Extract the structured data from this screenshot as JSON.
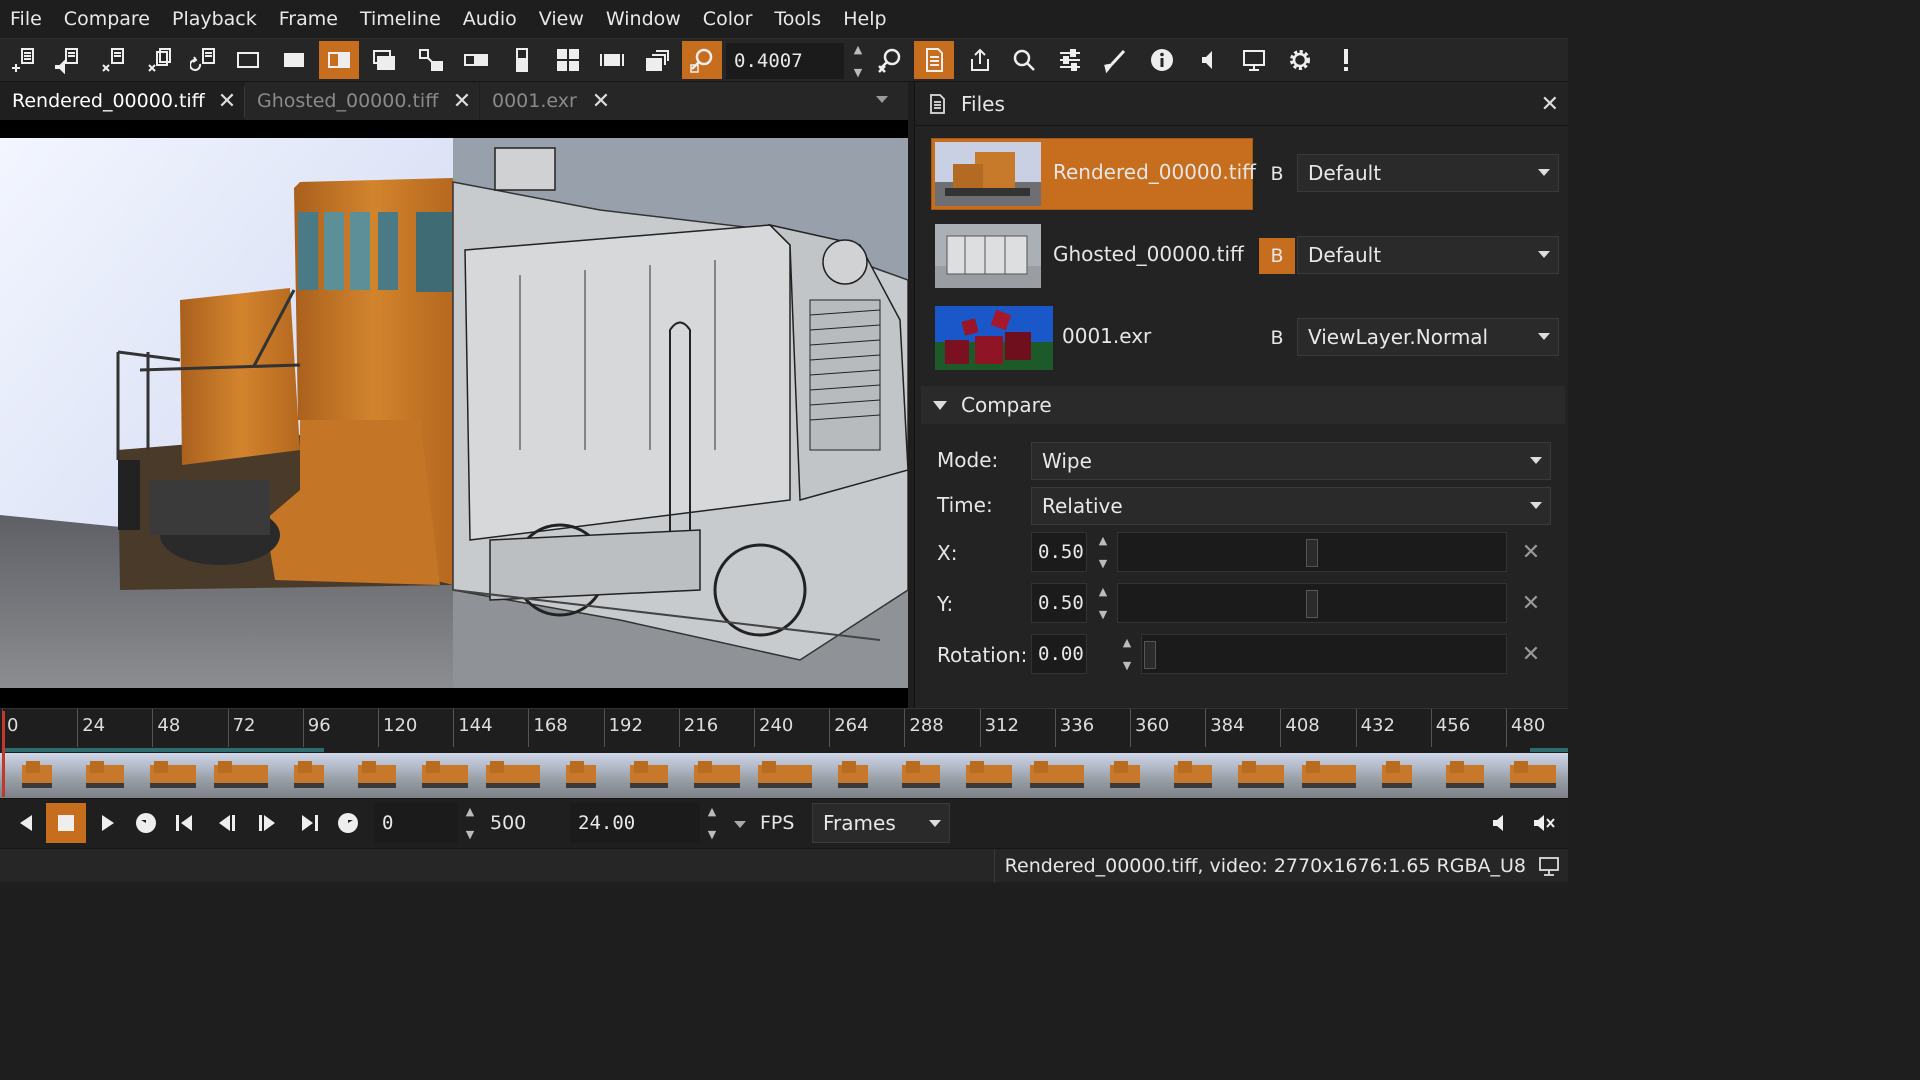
{
  "menu": [
    "File",
    "Compare",
    "Playback",
    "Frame",
    "Timeline",
    "Audio",
    "View",
    "Window",
    "Color",
    "Tools",
    "Help"
  ],
  "toolbar": {
    "zoom_value": "0.4007",
    "icons": [
      "open-icon",
      "open-audio-icon",
      "close-icon",
      "close-all-icon",
      "reload-icon",
      "compare-a-icon",
      "compare-b-icon",
      "compare-wipe-icon",
      "compare-overlay-icon",
      "compare-difference-icon",
      "compare-horizontal-icon",
      "compare-vertical-icon",
      "compare-tile-icon",
      "frame-view-icon",
      "full-screen-icon",
      "zoom-fit-icon",
      "zoom-reset-icon",
      "files-icon",
      "export-icon",
      "view-icon",
      "color-controls-icon",
      "annotation-icon",
      "info-icon",
      "audio-icon",
      "devices-icon",
      "settings-icon",
      "messages-icon"
    ],
    "active": [
      "compare-wipe-icon",
      "zoom-fit-icon",
      "files-icon"
    ]
  },
  "tabs": [
    {
      "label": "Rendered_00000.tiff",
      "active": true
    },
    {
      "label": "Ghosted_00000.tiff",
      "active": false
    },
    {
      "label": "0001.exr",
      "active": false
    }
  ],
  "panel": {
    "title": "Files",
    "files": [
      {
        "name": "Rendered_00000.tiff",
        "b_label": "B",
        "b_active": false,
        "layer": "Default",
        "selected": true
      },
      {
        "name": "Ghosted_00000.tiff",
        "b_label": "B",
        "b_active": true,
        "layer": "Default",
        "selected": false
      },
      {
        "name": "0001.exr",
        "b_label": "B",
        "b_active": false,
        "layer": "ViewLayer.Normal",
        "selected": false
      }
    ],
    "compare": {
      "title": "Compare",
      "mode_label": "Mode:",
      "mode_value": "Wipe",
      "time_label": "Time:",
      "time_value": "Relative",
      "x_label": "X:",
      "x_value": "0.50",
      "y_label": "Y:",
      "y_value": "0.50",
      "rotation_label": "Rotation:",
      "rotation_value": "0.00"
    }
  },
  "timeline": {
    "ticks": [
      "0",
      "24",
      "48",
      "72",
      "96",
      "120",
      "144",
      "168",
      "192",
      "216",
      "240",
      "264",
      "288",
      "312",
      "336",
      "360",
      "384",
      "408",
      "432",
      "456",
      "480"
    ],
    "current_frame": 0
  },
  "playback": {
    "current_frame": "0",
    "end_frame": "500",
    "fps": "24.00",
    "fps_label": "FPS",
    "time_units": "Frames"
  },
  "status": {
    "text": "Rendered_00000.tiff, video: 2770x1676:1.65 RGBA_U8"
  },
  "colors": {
    "accent": "#c66e1e",
    "background": "#1e1e1e",
    "cache": "#2f6c6c",
    "playhead": "#c0392b"
  }
}
